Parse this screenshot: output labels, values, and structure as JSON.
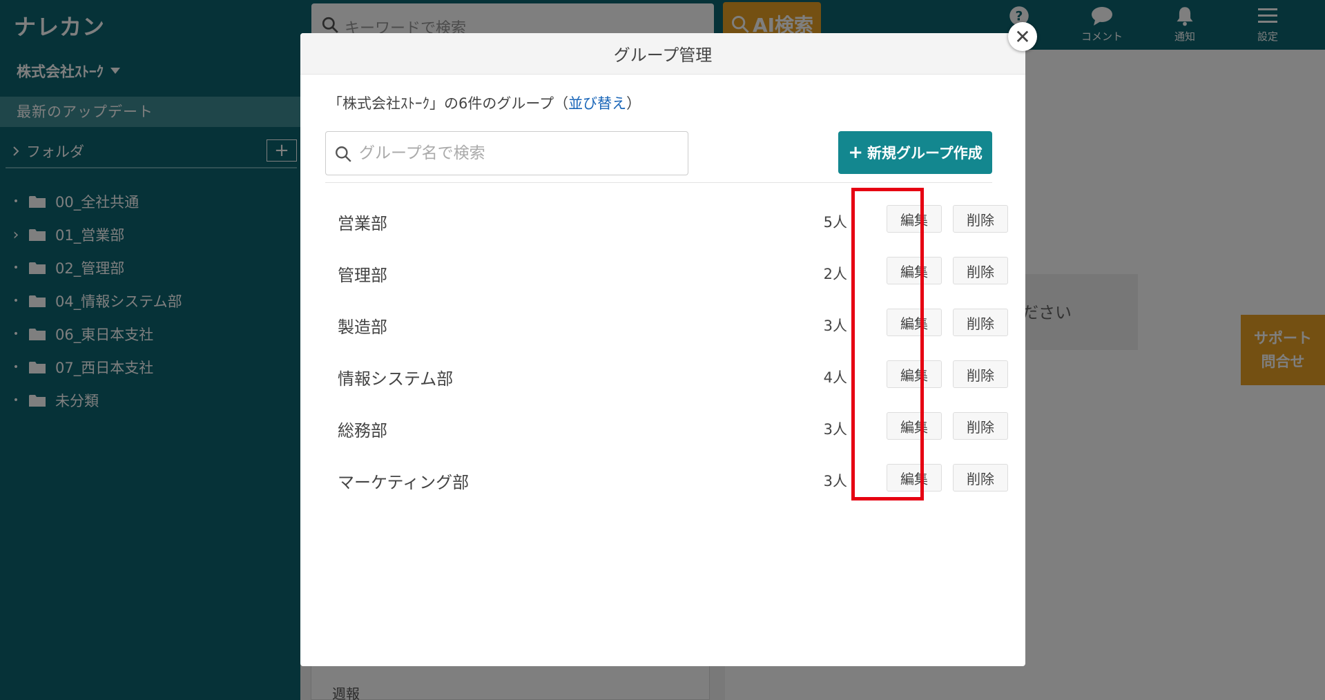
{
  "app": {
    "logo": "ナレカン"
  },
  "top": {
    "search_placeholder": "キーワードで検索",
    "ai_search_label": "AI検索",
    "icons": [
      {
        "name": "help-icon",
        "label": ""
      },
      {
        "name": "comment-icon",
        "label": "コメント"
      },
      {
        "name": "bell-icon",
        "label": "通知"
      },
      {
        "name": "menu-icon",
        "label": "設定"
      }
    ]
  },
  "sidebar": {
    "company": "株式会社ｽﾄｰｸ",
    "latest": "最新のアップデート",
    "folder_header": "フォルダ",
    "folders": [
      {
        "label": "00_全社共通",
        "marker": "•"
      },
      {
        "label": "01_営業部",
        "marker": "›"
      },
      {
        "label": "02_管理部",
        "marker": "•"
      },
      {
        "label": "04_情報システム部",
        "marker": "•"
      },
      {
        "label": "06_東日本支社",
        "marker": "•"
      },
      {
        "label": "07_西日本支社",
        "marker": "•"
      },
      {
        "label": "未分類",
        "marker": "•"
      }
    ]
  },
  "background": {
    "weekly_report": "週報",
    "card_text": "ださい",
    "support_line1": "サポート",
    "support_line2": "問合せ"
  },
  "modal": {
    "title": "グループ管理",
    "summary_prefix": "「株式会社ｽﾄｰｸ」の6件のグループ（",
    "summary_link": "並び替え",
    "summary_suffix": "）",
    "search_placeholder": "グループ名で検索",
    "new_group_label": "新規グループ作成",
    "groups": [
      {
        "name": "営業部",
        "count": "5人",
        "edit": "編集",
        "delete": "削除"
      },
      {
        "name": "管理部",
        "count": "2人",
        "edit": "編集",
        "delete": "削除"
      },
      {
        "name": "製造部",
        "count": "3人",
        "edit": "編集",
        "delete": "削除"
      },
      {
        "name": "情報システム部",
        "count": "4人",
        "edit": "編集",
        "delete": "削除"
      },
      {
        "name": "総務部",
        "count": "3人",
        "edit": "編集",
        "delete": "削除"
      },
      {
        "name": "マーケティング部",
        "count": "3人",
        "edit": "編集",
        "delete": "削除"
      }
    ]
  },
  "colors": {
    "brand": "#0d6570",
    "accent": "#13878f",
    "orange": "#e8a024",
    "highlight": "#e60012"
  }
}
